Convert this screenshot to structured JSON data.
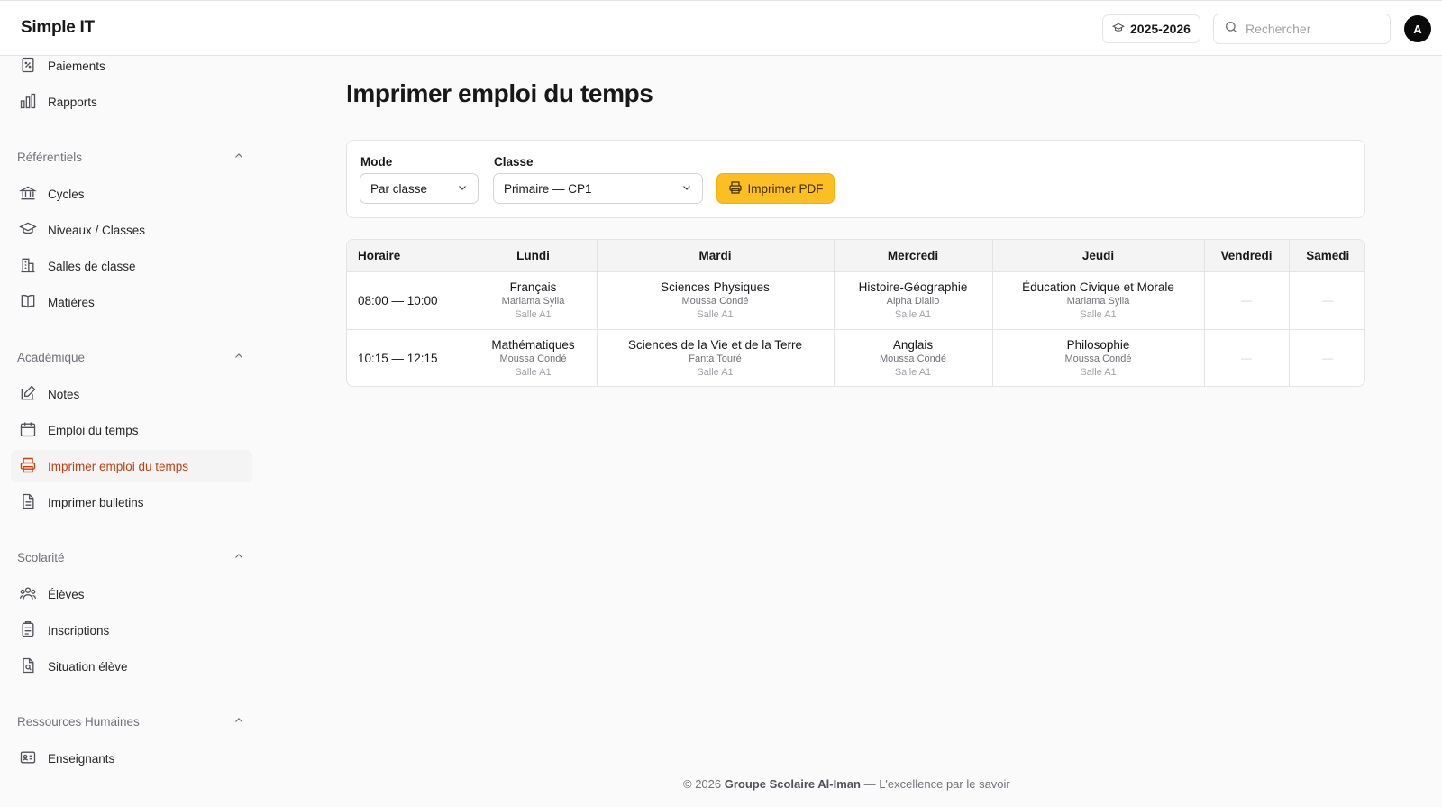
{
  "header": {
    "brand": "Simple IT",
    "year": "2025-2026",
    "search_placeholder": "Rechercher",
    "avatar_initial": "A"
  },
  "sidebar": {
    "top_items": [
      {
        "label": "Paiements",
        "icon": "receipt-percent-icon"
      },
      {
        "label": "Rapports",
        "icon": "bar-chart-icon"
      }
    ],
    "sections": [
      {
        "title": "Référentiels",
        "items": [
          {
            "label": "Cycles",
            "icon": "bank-icon"
          },
          {
            "label": "Niveaux / Classes",
            "icon": "graduation-cap-icon"
          },
          {
            "label": "Salles de classe",
            "icon": "building-icon"
          },
          {
            "label": "Matières",
            "icon": "book-icon"
          }
        ]
      },
      {
        "title": "Académique",
        "items": [
          {
            "label": "Notes",
            "icon": "pencil-square-icon"
          },
          {
            "label": "Emploi du temps",
            "icon": "calendar-icon"
          },
          {
            "label": "Imprimer emploi du temps",
            "icon": "printer-icon",
            "active": true
          },
          {
            "label": "Imprimer bulletins",
            "icon": "document-icon"
          }
        ]
      },
      {
        "title": "Scolarité",
        "items": [
          {
            "label": "Élèves",
            "icon": "users-icon"
          },
          {
            "label": "Inscriptions",
            "icon": "clipboard-icon"
          },
          {
            "label": "Situation élève",
            "icon": "document-search-icon"
          }
        ]
      },
      {
        "title": "Ressources Humaines",
        "items": [
          {
            "label": "Enseignants",
            "icon": "id-card-icon"
          }
        ]
      }
    ]
  },
  "main": {
    "title": "Imprimer emploi du temps",
    "filters": {
      "mode_label": "Mode",
      "mode_value": "Par classe",
      "class_label": "Classe",
      "class_value": "Primaire — CP1",
      "print_button": "Imprimer PDF"
    },
    "timetable": {
      "headers": [
        "Horaire",
        "Lundi",
        "Mardi",
        "Mercredi",
        "Jeudi",
        "Vendredi",
        "Samedi"
      ],
      "rows": [
        {
          "time": "08:00 — 10:00",
          "cells": [
            {
              "subject": "Français",
              "teacher": "Mariama Sylla",
              "room": "Salle A1"
            },
            {
              "subject": "Sciences Physiques",
              "teacher": "Moussa Condé",
              "room": "Salle A1"
            },
            {
              "subject": "Histoire-Géographie",
              "teacher": "Alpha Diallo",
              "room": "Salle A1"
            },
            {
              "subject": "Éducation Civique et Morale",
              "teacher": "Mariama Sylla",
              "room": "Salle A1"
            },
            {
              "empty": "—"
            },
            {
              "empty": "—"
            }
          ]
        },
        {
          "time": "10:15 — 12:15",
          "cells": [
            {
              "subject": "Mathématiques",
              "teacher": "Moussa Condé",
              "room": "Salle A1"
            },
            {
              "subject": "Sciences de la Vie et de la Terre",
              "teacher": "Fanta Touré",
              "room": "Salle A1"
            },
            {
              "subject": "Anglais",
              "teacher": "Moussa Condé",
              "room": "Salle A1"
            },
            {
              "subject": "Philosophie",
              "teacher": "Moussa Condé",
              "room": "Salle A1"
            },
            {
              "empty": "—"
            },
            {
              "empty": "—"
            }
          ]
        }
      ]
    }
  },
  "footer": {
    "prefix": "© 2026 ",
    "org": "Groupe Scolaire Al-Iman",
    "suffix": " — L'excellence par le savoir"
  },
  "colors": {
    "accent": "#fbbf24",
    "active_text": "#c2410c",
    "border": "#e4e4e7"
  }
}
